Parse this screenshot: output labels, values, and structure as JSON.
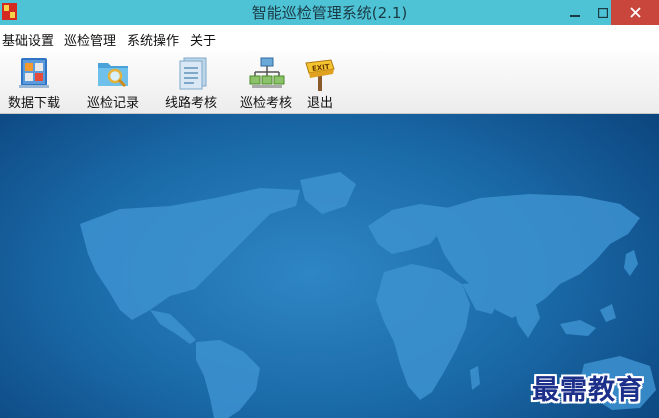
{
  "window": {
    "title": "智能巡检管理系统(2.1)"
  },
  "menu": [
    {
      "label": "基础设置"
    },
    {
      "label": "巡检管理"
    },
    {
      "label": "系统操作"
    },
    {
      "label": "关于"
    }
  ],
  "toolbar": [
    {
      "label": "数据下载",
      "icon": "data-download-icon"
    },
    {
      "label": "巡检记录",
      "icon": "inspection-record-icon"
    },
    {
      "label": "线路考核",
      "icon": "route-assessment-icon"
    },
    {
      "label": "巡检考核",
      "icon": "inspection-assessment-icon"
    },
    {
      "label": "退出",
      "icon": "exit-icon",
      "icon_text": "EXIT"
    }
  ],
  "watermark": "最需教育",
  "colors": {
    "titlebar": "#4fc3d6",
    "close": "#c9463d",
    "desktop": "#1a6aa8",
    "watermark": "#1c2f8a"
  }
}
